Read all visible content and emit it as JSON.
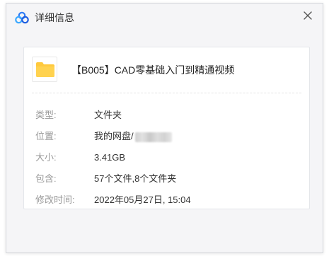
{
  "window": {
    "title": "详细信息",
    "close_glyph": "✕"
  },
  "file": {
    "name": "【B005】CAD零基础入门到精通视频",
    "icon": "folder-icon",
    "icon_color": "#FFC93D"
  },
  "details": {
    "type": {
      "label": "类型:",
      "value": "文件夹"
    },
    "location": {
      "label": "位置:",
      "value": "我的网盘/"
    },
    "size": {
      "label": "大小:",
      "value": "3.41GB"
    },
    "contains": {
      "label": "包含:",
      "value": "57个文件,8个文件夹"
    },
    "modified": {
      "label": "修改时间:",
      "value": "2022年05月27日, 15:04"
    }
  },
  "colors": {
    "brand_blue": "#2E7CF6",
    "label_gray": "#999999",
    "value_text": "#333333"
  }
}
